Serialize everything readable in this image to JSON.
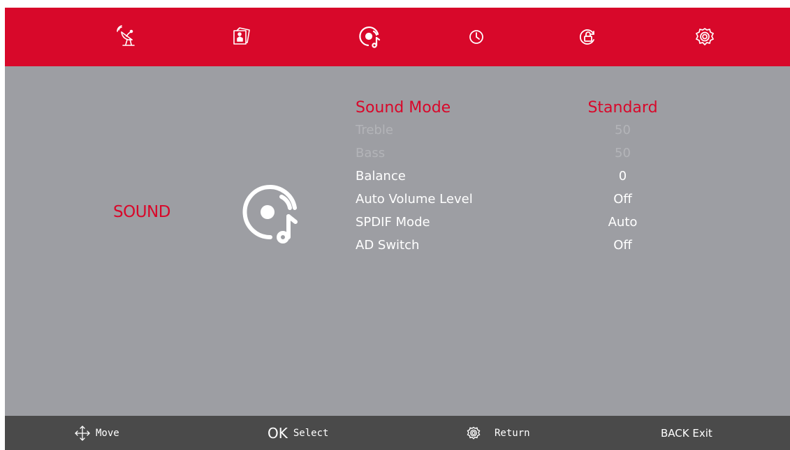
{
  "colors": {
    "accent": "#d8082a",
    "panel": "#9d9ea3",
    "footer": "#4a4a4a",
    "text": "#ffffff",
    "disabled": "#b3b4b8"
  },
  "tabs": [
    {
      "icon": "satellite-dish-icon"
    },
    {
      "icon": "picture-icon"
    },
    {
      "icon": "sound-disc-icon",
      "active": true
    },
    {
      "icon": "clock-icon"
    },
    {
      "icon": "lock-icon"
    },
    {
      "icon": "gear-icon"
    }
  ],
  "category": {
    "title": "SOUND",
    "icon": "sound-disc-icon"
  },
  "menu": {
    "items": [
      {
        "label": "Sound Mode",
        "value": "Standard",
        "state": "selected"
      },
      {
        "label": "Treble",
        "value": "50",
        "state": "disabled"
      },
      {
        "label": "Bass",
        "value": "50",
        "state": "disabled"
      },
      {
        "label": "Balance",
        "value": "0",
        "state": "normal"
      },
      {
        "label": "Auto Volume Level",
        "value": "Off",
        "state": "normal"
      },
      {
        "label": "SPDIF Mode",
        "value": "Auto",
        "state": "normal"
      },
      {
        "label": "AD Switch",
        "value": "Off",
        "state": "normal"
      }
    ]
  },
  "footer": {
    "move_label": "Move",
    "ok_glyph": "OK",
    "select_label": "Select",
    "return_label": "Return",
    "exit_label": "BACK Exit"
  }
}
